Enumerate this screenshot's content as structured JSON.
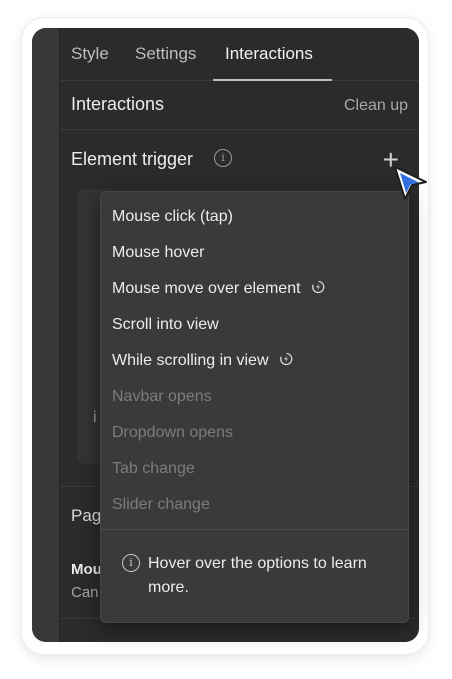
{
  "tabs": [
    {
      "label": "Style"
    },
    {
      "label": "Settings"
    },
    {
      "label": "Interactions"
    }
  ],
  "section": {
    "title": "Interactions",
    "cleanup_label": "Clean up"
  },
  "trigger": {
    "title": "Element trigger",
    "info_glyph": "i",
    "add_glyph": "+"
  },
  "background": {
    "inner_hint": "i",
    "page_label": "Pag",
    "mouse_label": "Mou",
    "can_label": "Can"
  },
  "menu": {
    "items": [
      {
        "label": "Mouse click (tap)",
        "disabled": false,
        "icon": ""
      },
      {
        "label": "Mouse hover",
        "disabled": false,
        "icon": ""
      },
      {
        "label": "Mouse move over element",
        "disabled": false,
        "icon": "lightning-icon"
      },
      {
        "label": "Scroll into view",
        "disabled": false,
        "icon": ""
      },
      {
        "label": "While scrolling in view",
        "disabled": false,
        "icon": "lightning-icon"
      },
      {
        "label": "Navbar opens",
        "disabled": true,
        "icon": ""
      },
      {
        "label": "Dropdown opens",
        "disabled": true,
        "icon": ""
      },
      {
        "label": "Tab change",
        "disabled": true,
        "icon": ""
      },
      {
        "label": "Slider change",
        "disabled": true,
        "icon": ""
      }
    ],
    "info_glyph": "i",
    "info_text": "Hover over the options to learn more."
  },
  "colors": {
    "panel_bg": "#2b2b2b",
    "menu_bg": "#3a3a3a",
    "text": "#ececec",
    "disabled": "#7c7c7c",
    "cursor_fill": "#2f6fe0"
  }
}
